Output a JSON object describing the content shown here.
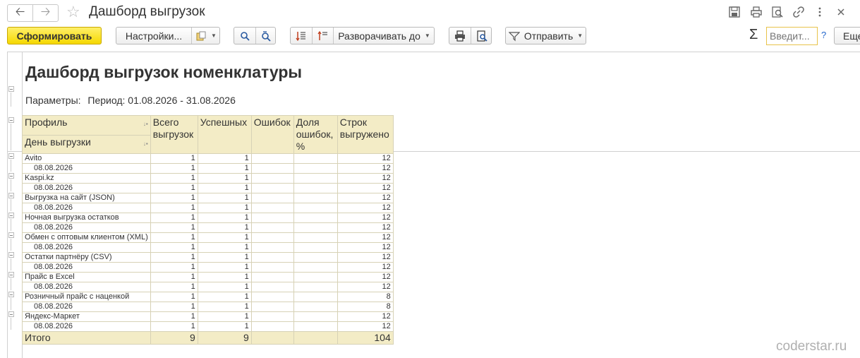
{
  "window": {
    "title": "Дашборд выгрузок"
  },
  "toolbar": {
    "generate_label": "Сформировать",
    "settings_label": "Настройки...",
    "expand_label": "Разворачивать до",
    "send_label": "Отправить",
    "search_placeholder": "Введит...",
    "help_label": "?",
    "more_label": "Еще",
    "sum_label": "Σ"
  },
  "report": {
    "title": "Дашборд выгрузок номенклатуры",
    "params_label": "Параметры:",
    "params_value": "Период: 01.08.2026 - 31.08.2026",
    "columns": {
      "profile": "Профиль",
      "day": "День выгрузки",
      "total": "Всего выгрузок",
      "success": "Успешных",
      "errors": "Ошибок",
      "error_share": "Доля ошибок, %",
      "rows": "Строк выгружено"
    },
    "groups": [
      {
        "profile": "Avito",
        "total": "1",
        "success": "1",
        "errors": "",
        "share": "",
        "rows": "12",
        "day": "08.08.2026",
        "d_total": "1",
        "d_success": "1",
        "d_errors": "",
        "d_share": "",
        "d_rows": "12"
      },
      {
        "profile": "Kaspi.kz",
        "total": "1",
        "success": "1",
        "errors": "",
        "share": "",
        "rows": "12",
        "day": "08.08.2026",
        "d_total": "1",
        "d_success": "1",
        "d_errors": "",
        "d_share": "",
        "d_rows": "12"
      },
      {
        "profile": "Выгрузка на сайт (JSON)",
        "total": "1",
        "success": "1",
        "errors": "",
        "share": "",
        "rows": "12",
        "day": "08.08.2026",
        "d_total": "1",
        "d_success": "1",
        "d_errors": "",
        "d_share": "",
        "d_rows": "12"
      },
      {
        "profile": "Ночная выгрузка остатков",
        "total": "1",
        "success": "1",
        "errors": "",
        "share": "",
        "rows": "12",
        "day": "08.08.2026",
        "d_total": "1",
        "d_success": "1",
        "d_errors": "",
        "d_share": "",
        "d_rows": "12"
      },
      {
        "profile": "Обмен с оптовым клиентом (XML)",
        "total": "1",
        "success": "1",
        "errors": "",
        "share": "",
        "rows": "12",
        "day": "08.08.2026",
        "d_total": "1",
        "d_success": "1",
        "d_errors": "",
        "d_share": "",
        "d_rows": "12"
      },
      {
        "profile": "Остатки партнёру (CSV)",
        "total": "1",
        "success": "1",
        "errors": "",
        "share": "",
        "rows": "12",
        "day": "08.08.2026",
        "d_total": "1",
        "d_success": "1",
        "d_errors": "",
        "d_share": "",
        "d_rows": "12"
      },
      {
        "profile": "Прайс в Excel",
        "total": "1",
        "success": "1",
        "errors": "",
        "share": "",
        "rows": "12",
        "day": "08.08.2026",
        "d_total": "1",
        "d_success": "1",
        "d_errors": "",
        "d_share": "",
        "d_rows": "12"
      },
      {
        "profile": "Розничный прайс с наценкой",
        "total": "1",
        "success": "1",
        "errors": "",
        "share": "",
        "rows": "8",
        "day": "08.08.2026",
        "d_total": "1",
        "d_success": "1",
        "d_errors": "",
        "d_share": "",
        "d_rows": "8"
      },
      {
        "profile": "Яндекс-Маркет",
        "total": "1",
        "success": "1",
        "errors": "",
        "share": "",
        "rows": "12",
        "day": "08.08.2026",
        "d_total": "1",
        "d_success": "1",
        "d_errors": "",
        "d_share": "",
        "d_rows": "12"
      }
    ],
    "totals": {
      "label": "Итого",
      "total": "9",
      "success": "9",
      "errors": "",
      "share": "",
      "rows": "104"
    }
  },
  "watermark": "coderstar.ru",
  "icons": {
    "back": "arrow-left-icon",
    "forward": "arrow-right-icon",
    "favorite": "star-icon",
    "save": "floppy-disk-icon",
    "print": "printer-icon",
    "preview": "magnifier-page-icon",
    "link": "link-icon",
    "more": "vertical-dots-icon",
    "close": "close-icon"
  },
  "colors": {
    "primary_button": "#f5d800",
    "table_header": "#f3ecc6",
    "search_border": "#e8c34a"
  }
}
